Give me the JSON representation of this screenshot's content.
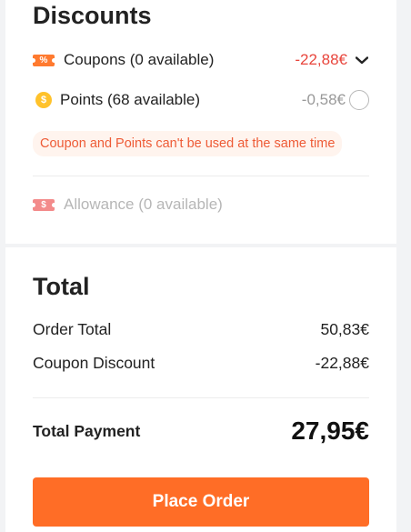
{
  "discounts": {
    "title": "Discounts",
    "coupons": {
      "label": "Coupons (0 available)",
      "value": "-22,88€",
      "icon_text": "%"
    },
    "points": {
      "label": "Points (68 available)",
      "value": "-0,58€",
      "icon_text": "$"
    },
    "notice": "Coupon and Points can't be used at the same time",
    "allowance": {
      "label": "Allowance (0 available)",
      "icon_text": "$"
    }
  },
  "total": {
    "title": "Total",
    "order_total_label": "Order Total",
    "order_total_value": "50,83€",
    "coupon_discount_label": "Coupon Discount",
    "coupon_discount_value": "-22,88€",
    "payment_label": "Total Payment",
    "payment_value": "27,95€"
  },
  "cta": {
    "label": "Place Order"
  },
  "colors": {
    "accent": "#ff6d26",
    "discount_red": "#e8453c",
    "coupon_icon": "#ff7a2f",
    "points_icon": "#ffc22b"
  },
  "icons": [
    "coupon-icon",
    "chevron-down-icon",
    "points-coin-icon",
    "radio-unchecked-icon",
    "allowance-icon"
  ]
}
